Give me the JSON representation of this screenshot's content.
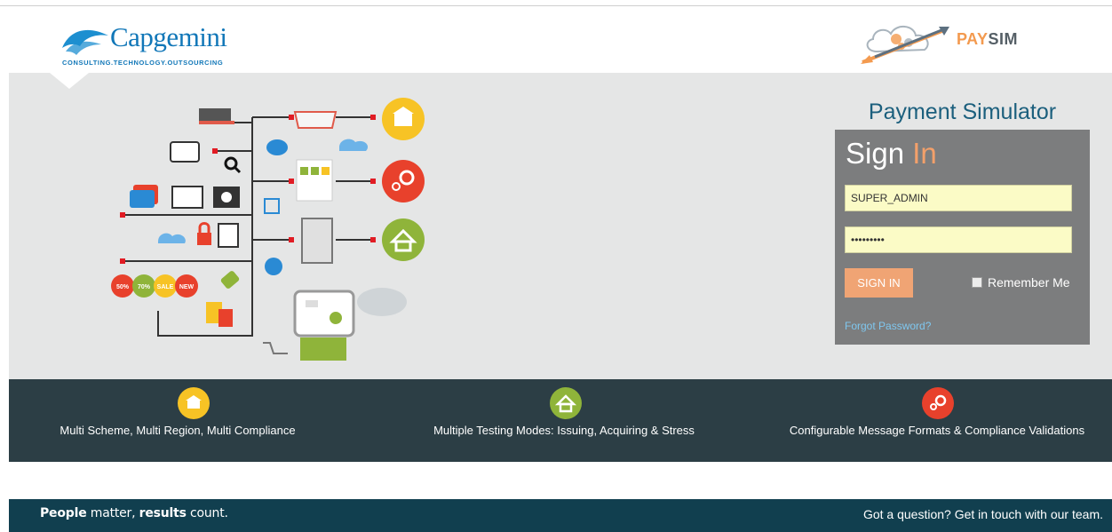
{
  "header": {
    "logo": {
      "name": "Capgemini",
      "tagline": "CONSULTING.TECHNOLOGY.OUTSOURCING"
    },
    "paysim": {
      "part1": "PAY",
      "part2": "SIM"
    }
  },
  "login": {
    "title": "Payment Simulator",
    "heading_main": "Sign",
    "heading_accent": "In",
    "username_value": "SUPER_ADMIN",
    "password_value": "SUPER_ADM",
    "signin_label": "SIGN IN",
    "remember_label": "Remember Me",
    "forgot_label": "Forgot Password?"
  },
  "illustration": {
    "tags": [
      "50%",
      "70%",
      "SALE",
      "NEW"
    ]
  },
  "features": [
    {
      "label": "Multi Scheme, Multi Region, Multi Compliance",
      "icon": "bank-icon",
      "color": "#f7c325"
    },
    {
      "label": "Multiple Testing Modes: Issuing, Acquiring & Stress",
      "icon": "house-icon",
      "color": "#8fb43a"
    },
    {
      "label": "Configurable Message Formats & Compliance Validations",
      "icon": "gears-icon",
      "color": "#e8412c"
    }
  ],
  "footer": {
    "tagline_1": "People",
    "tagline_2": " matter, ",
    "tagline_3": "results",
    "tagline_4": " count.",
    "contact": "Got a question? Get in touch with our team."
  },
  "colors": {
    "hero_bg": "#e5e6e6",
    "features_bg": "#2c3e45",
    "footer_bg": "#113f4f",
    "accent": "#f0a474",
    "title": "#1b5f7d"
  }
}
